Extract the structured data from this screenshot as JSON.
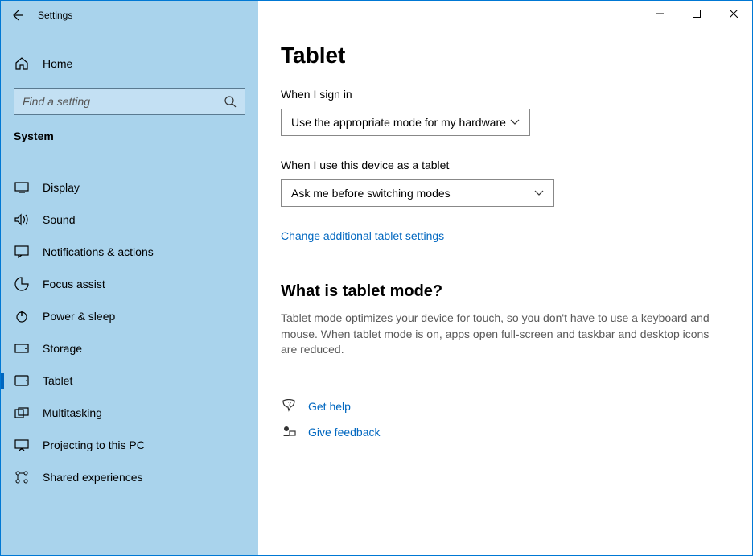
{
  "titlebar": {
    "title": "Settings"
  },
  "sidebar": {
    "home_label": "Home",
    "search_placeholder": "Find a setting",
    "section": "System",
    "items": [
      {
        "label": "Display"
      },
      {
        "label": "Sound"
      },
      {
        "label": "Notifications & actions"
      },
      {
        "label": "Focus assist"
      },
      {
        "label": "Power & sleep"
      },
      {
        "label": "Storage"
      },
      {
        "label": "Tablet"
      },
      {
        "label": "Multitasking"
      },
      {
        "label": "Projecting to this PC"
      },
      {
        "label": "Shared experiences"
      }
    ]
  },
  "main": {
    "heading": "Tablet",
    "signin_label": "When I sign in",
    "signin_value": "Use the appropriate mode for my hardware",
    "tablet_use_label": "When I use this device as a tablet",
    "tablet_use_value": "Ask me before switching modes",
    "change_link": "Change additional tablet settings",
    "what_heading": "What is tablet mode?",
    "what_desc": "Tablet mode optimizes your device for touch, so you don't have to use a keyboard and mouse. When tablet mode is on, apps open full-screen and taskbar and desktop icons are reduced.",
    "get_help": "Get help",
    "give_feedback": "Give feedback"
  }
}
